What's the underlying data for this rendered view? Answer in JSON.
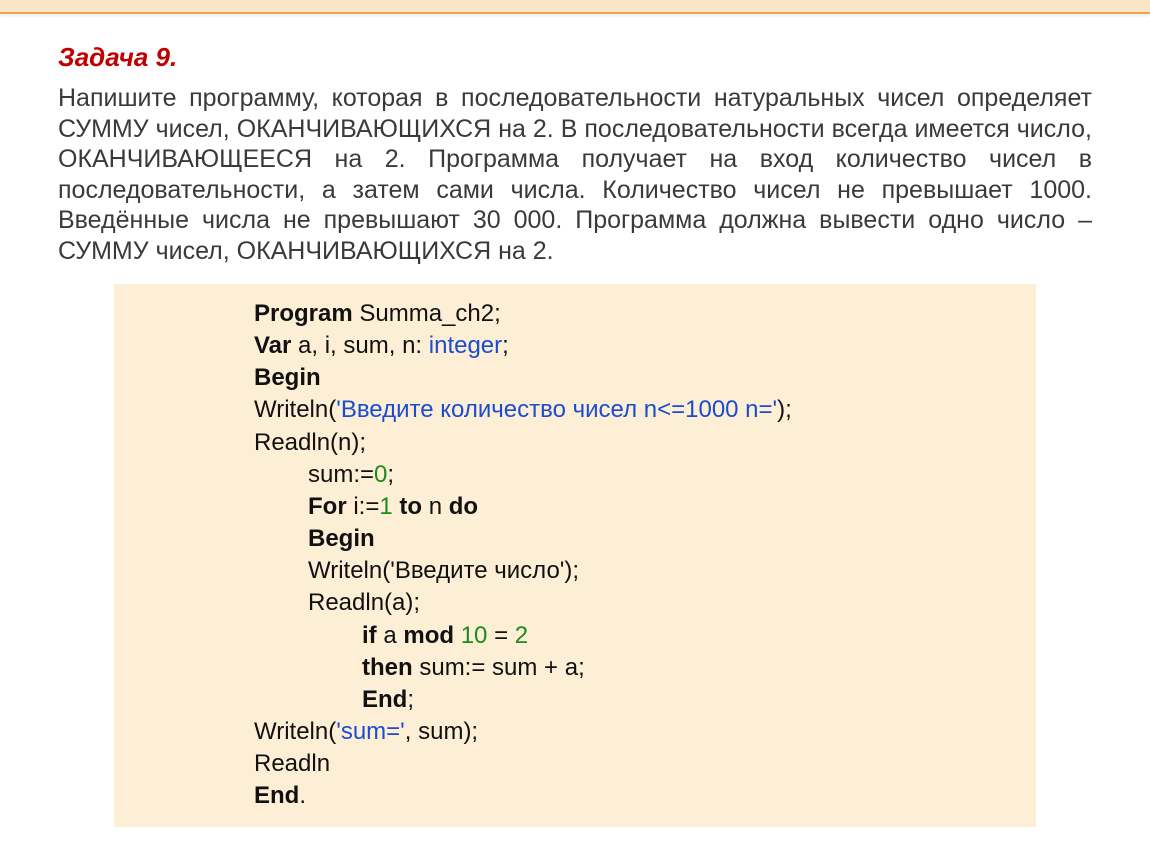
{
  "title": "Задача 9.",
  "description": "Напишите программу, которая в последовательности натуральных чисел определяет СУММУ чисел, ОКАНЧИВАЮЩИХСЯ на 2. В последовательности всегда имеется число, ОКАНЧИВАЮЩЕЕСЯ на 2. Программа получает на вход количество чисел в последовательности, а затем сами числа. Количество чисел не превышает 1000. Введённые числа не превышают 30 000. Программа должна вывести одно число – СУММУ чисел, ОКАНЧИВАЮЩИХСЯ на 2.",
  "code": {
    "kw_program": "Program",
    "prog_name": " Summa_ch2;",
    "kw_var": "Var",
    "var_decl": " a, i, sum, n: ",
    "type_integer": "integer",
    "semicolon": ";",
    "kw_begin": "Begin",
    "writeln1_a": "Writeln(",
    "writeln1_str": "'Введите количество чисел n<=1000 n='",
    "writeln1_b": ");",
    "readln_n": "Readln(n);",
    "sum_init_a": "sum:=",
    "sum_init_val": "0",
    "sum_init_b": ";",
    "kw_for": "For",
    "for_mid_a": " i:=",
    "for_one": "1",
    "kw_to": " to",
    "for_mid_b": " n ",
    "kw_do": "do",
    "kw_begin2": "Begin",
    "writeln2": "Writeln('Введите число');",
    "readln_a": "Readln(a);",
    "kw_if": "if",
    "if_mid_a": " a ",
    "kw_mod": "mod",
    "mod_ten": " 10",
    "if_mid_b": " = ",
    "if_two": "2",
    "kw_then": "then",
    "then_body": " sum:= sum + a;",
    "kw_end1": "End",
    "end1_semi": ";",
    "writeln3_a": "Writeln(",
    "writeln3_str": "'sum='",
    "writeln3_b": ", sum);",
    "readln_final": "Readln",
    "kw_end2": "End",
    "end2_dot": "."
  }
}
